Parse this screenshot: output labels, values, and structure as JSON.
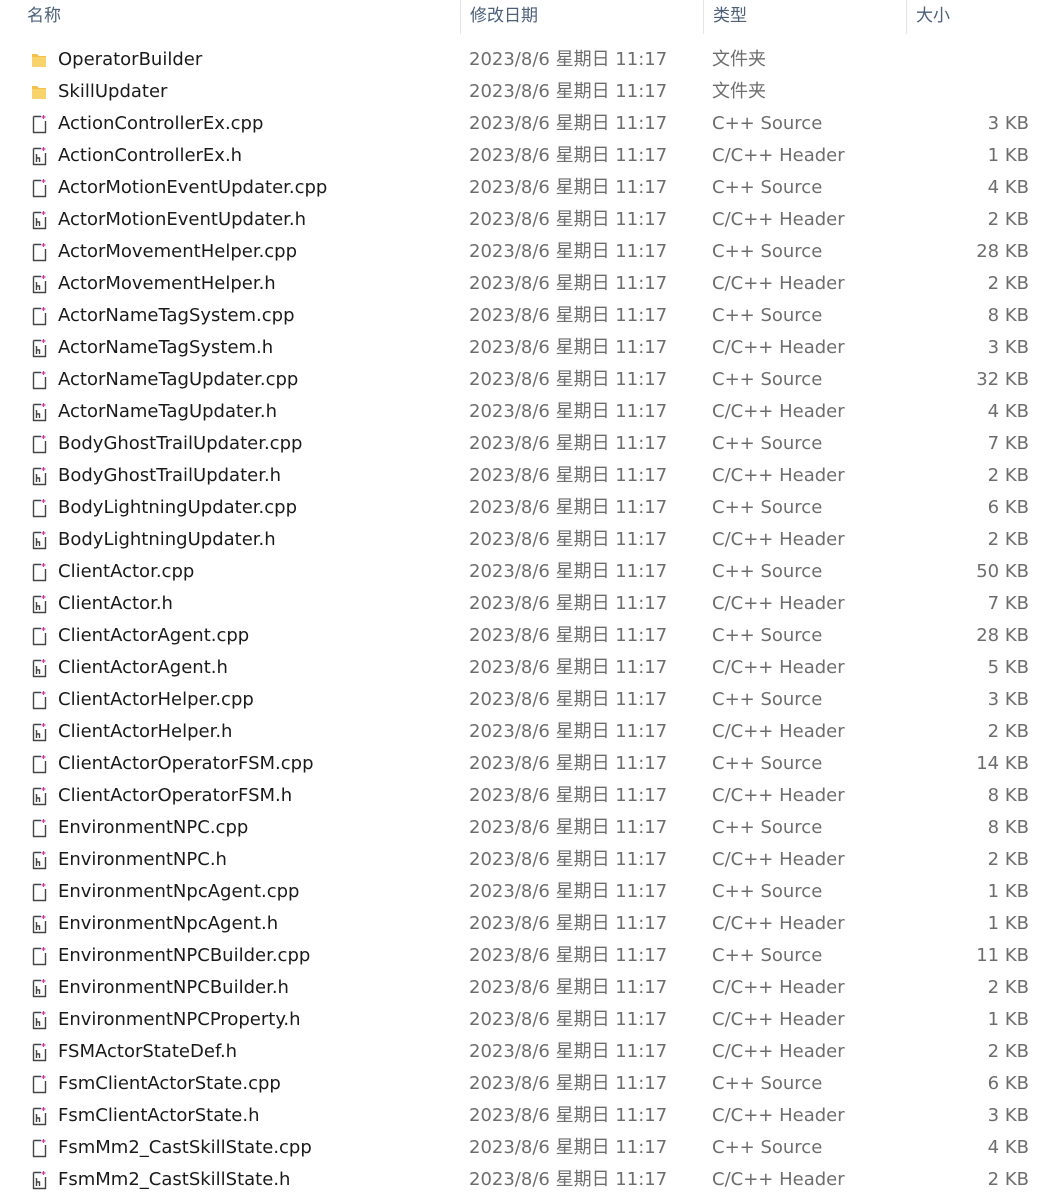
{
  "columns": {
    "name": "名称",
    "date": "修改日期",
    "type": "类型",
    "size": "大小"
  },
  "colors": {
    "folder": "#f5c14a",
    "header_text": "#4c607a",
    "cpp_icon": "#444444",
    "h_icon": "#444444",
    "accent": "#c43fa6"
  },
  "files": [
    {
      "name": "OperatorBuilder",
      "date": "2023/8/6 星期日 11:17",
      "type": "文件夹",
      "size": "",
      "icon": "folder-icon"
    },
    {
      "name": "SkillUpdater",
      "date": "2023/8/6 星期日 11:17",
      "type": "文件夹",
      "size": "",
      "icon": "folder-icon"
    },
    {
      "name": "ActionControllerEx.cpp",
      "date": "2023/8/6 星期日 11:17",
      "type": "C++ Source",
      "size": "3 KB",
      "icon": "cpp-file-icon"
    },
    {
      "name": "ActionControllerEx.h",
      "date": "2023/8/6 星期日 11:17",
      "type": "C/C++ Header",
      "size": "1 KB",
      "icon": "header-file-icon"
    },
    {
      "name": "ActorMotionEventUpdater.cpp",
      "date": "2023/8/6 星期日 11:17",
      "type": "C++ Source",
      "size": "4 KB",
      "icon": "cpp-file-icon"
    },
    {
      "name": "ActorMotionEventUpdater.h",
      "date": "2023/8/6 星期日 11:17",
      "type": "C/C++ Header",
      "size": "2 KB",
      "icon": "header-file-icon"
    },
    {
      "name": "ActorMovementHelper.cpp",
      "date": "2023/8/6 星期日 11:17",
      "type": "C++ Source",
      "size": "28 KB",
      "icon": "cpp-file-icon"
    },
    {
      "name": "ActorMovementHelper.h",
      "date": "2023/8/6 星期日 11:17",
      "type": "C/C++ Header",
      "size": "2 KB",
      "icon": "header-file-icon"
    },
    {
      "name": "ActorNameTagSystem.cpp",
      "date": "2023/8/6 星期日 11:17",
      "type": "C++ Source",
      "size": "8 KB",
      "icon": "cpp-file-icon"
    },
    {
      "name": "ActorNameTagSystem.h",
      "date": "2023/8/6 星期日 11:17",
      "type": "C/C++ Header",
      "size": "3 KB",
      "icon": "header-file-icon"
    },
    {
      "name": "ActorNameTagUpdater.cpp",
      "date": "2023/8/6 星期日 11:17",
      "type": "C++ Source",
      "size": "32 KB",
      "icon": "cpp-file-icon"
    },
    {
      "name": "ActorNameTagUpdater.h",
      "date": "2023/8/6 星期日 11:17",
      "type": "C/C++ Header",
      "size": "4 KB",
      "icon": "header-file-icon"
    },
    {
      "name": "BodyGhostTrailUpdater.cpp",
      "date": "2023/8/6 星期日 11:17",
      "type": "C++ Source",
      "size": "7 KB",
      "icon": "cpp-file-icon"
    },
    {
      "name": "BodyGhostTrailUpdater.h",
      "date": "2023/8/6 星期日 11:17",
      "type": "C/C++ Header",
      "size": "2 KB",
      "icon": "header-file-icon"
    },
    {
      "name": "BodyLightningUpdater.cpp",
      "date": "2023/8/6 星期日 11:17",
      "type": "C++ Source",
      "size": "6 KB",
      "icon": "cpp-file-icon"
    },
    {
      "name": "BodyLightningUpdater.h",
      "date": "2023/8/6 星期日 11:17",
      "type": "C/C++ Header",
      "size": "2 KB",
      "icon": "header-file-icon"
    },
    {
      "name": "ClientActor.cpp",
      "date": "2023/8/6 星期日 11:17",
      "type": "C++ Source",
      "size": "50 KB",
      "icon": "cpp-file-icon"
    },
    {
      "name": "ClientActor.h",
      "date": "2023/8/6 星期日 11:17",
      "type": "C/C++ Header",
      "size": "7 KB",
      "icon": "header-file-icon"
    },
    {
      "name": "ClientActorAgent.cpp",
      "date": "2023/8/6 星期日 11:17",
      "type": "C++ Source",
      "size": "28 KB",
      "icon": "cpp-file-icon"
    },
    {
      "name": "ClientActorAgent.h",
      "date": "2023/8/6 星期日 11:17",
      "type": "C/C++ Header",
      "size": "5 KB",
      "icon": "header-file-icon"
    },
    {
      "name": "ClientActorHelper.cpp",
      "date": "2023/8/6 星期日 11:17",
      "type": "C++ Source",
      "size": "3 KB",
      "icon": "cpp-file-icon"
    },
    {
      "name": "ClientActorHelper.h",
      "date": "2023/8/6 星期日 11:17",
      "type": "C/C++ Header",
      "size": "2 KB",
      "icon": "header-file-icon"
    },
    {
      "name": "ClientActorOperatorFSM.cpp",
      "date": "2023/8/6 星期日 11:17",
      "type": "C++ Source",
      "size": "14 KB",
      "icon": "cpp-file-icon"
    },
    {
      "name": "ClientActorOperatorFSM.h",
      "date": "2023/8/6 星期日 11:17",
      "type": "C/C++ Header",
      "size": "8 KB",
      "icon": "header-file-icon"
    },
    {
      "name": "EnvironmentNPC.cpp",
      "date": "2023/8/6 星期日 11:17",
      "type": "C++ Source",
      "size": "8 KB",
      "icon": "cpp-file-icon"
    },
    {
      "name": "EnvironmentNPC.h",
      "date": "2023/8/6 星期日 11:17",
      "type": "C/C++ Header",
      "size": "2 KB",
      "icon": "header-file-icon"
    },
    {
      "name": "EnvironmentNpcAgent.cpp",
      "date": "2023/8/6 星期日 11:17",
      "type": "C++ Source",
      "size": "1 KB",
      "icon": "cpp-file-icon"
    },
    {
      "name": "EnvironmentNpcAgent.h",
      "date": "2023/8/6 星期日 11:17",
      "type": "C/C++ Header",
      "size": "1 KB",
      "icon": "header-file-icon"
    },
    {
      "name": "EnvironmentNPCBuilder.cpp",
      "date": "2023/8/6 星期日 11:17",
      "type": "C++ Source",
      "size": "11 KB",
      "icon": "cpp-file-icon"
    },
    {
      "name": "EnvironmentNPCBuilder.h",
      "date": "2023/8/6 星期日 11:17",
      "type": "C/C++ Header",
      "size": "2 KB",
      "icon": "header-file-icon"
    },
    {
      "name": "EnvironmentNPCProperty.h",
      "date": "2023/8/6 星期日 11:17",
      "type": "C/C++ Header",
      "size": "1 KB",
      "icon": "header-file-icon"
    },
    {
      "name": "FSMActorStateDef.h",
      "date": "2023/8/6 星期日 11:17",
      "type": "C/C++ Header",
      "size": "2 KB",
      "icon": "header-file-icon"
    },
    {
      "name": "FsmClientActorState.cpp",
      "date": "2023/8/6 星期日 11:17",
      "type": "C++ Source",
      "size": "6 KB",
      "icon": "cpp-file-icon"
    },
    {
      "name": "FsmClientActorState.h",
      "date": "2023/8/6 星期日 11:17",
      "type": "C/C++ Header",
      "size": "3 KB",
      "icon": "header-file-icon"
    },
    {
      "name": "FsmMm2_CastSkillState.cpp",
      "date": "2023/8/6 星期日 11:17",
      "type": "C++ Source",
      "size": "4 KB",
      "icon": "cpp-file-icon"
    },
    {
      "name": "FsmMm2_CastSkillState.h",
      "date": "2023/8/6 星期日 11:17",
      "type": "C/C++ Header",
      "size": "2 KB",
      "icon": "header-file-icon"
    }
  ]
}
